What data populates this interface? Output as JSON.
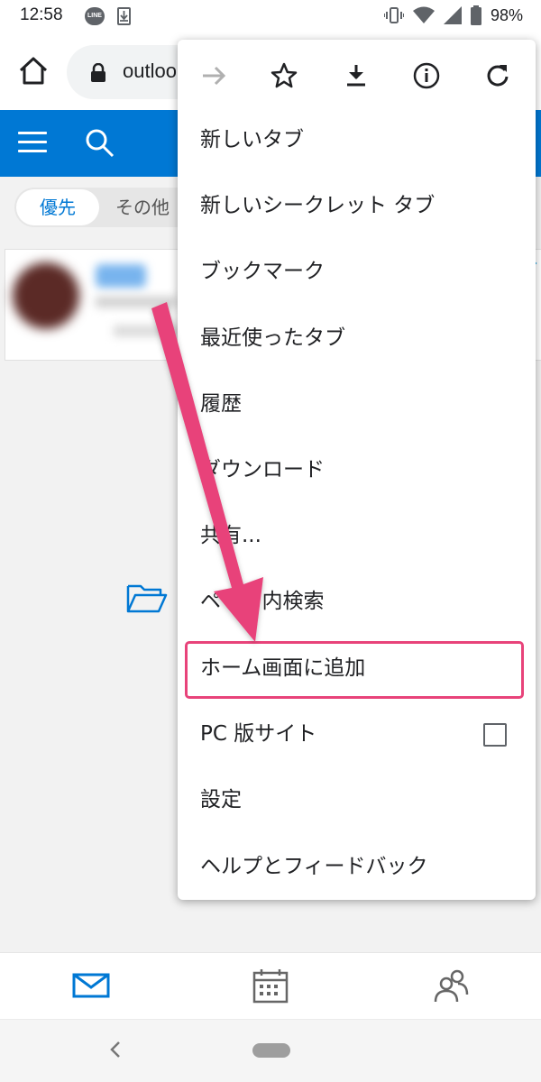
{
  "status_bar": {
    "time": "12:58",
    "line_badge": "LINE",
    "battery": "98%",
    "icons": [
      "line-app-icon",
      "download-notification-icon",
      "vibrate-icon",
      "wifi-icon",
      "signal-icon",
      "battery-icon"
    ]
  },
  "browser": {
    "url_text": "outloo",
    "icons": [
      "home-icon",
      "lock-icon"
    ]
  },
  "outlook_header": {
    "icons": [
      "menu-icon",
      "search-icon"
    ],
    "accent_color": "#0078d4"
  },
  "filters": {
    "active": "優先",
    "other": "その他"
  },
  "menu": {
    "icon_row": [
      "forward-icon",
      "star-icon",
      "download-icon",
      "info-icon",
      "refresh-icon"
    ],
    "items": [
      {
        "label": "新しいタブ"
      },
      {
        "label": "新しいシークレット タブ"
      },
      {
        "label": "ブックマーク"
      },
      {
        "label": "最近使ったタブ"
      },
      {
        "label": "履歴"
      },
      {
        "label": "ダウンロード"
      },
      {
        "label": "共有..."
      },
      {
        "label": "ページ内検索"
      },
      {
        "label": "ホーム画面に追加"
      },
      {
        "label": "PC 版サイト"
      },
      {
        "label": "設定"
      },
      {
        "label": "ヘルプとフィードバック"
      }
    ],
    "highlighted_item": "ホーム画面に追加",
    "highlight_color": "#e8437a"
  },
  "bottom_tabs": [
    "mail-icon",
    "calendar-icon",
    "people-icon"
  ]
}
